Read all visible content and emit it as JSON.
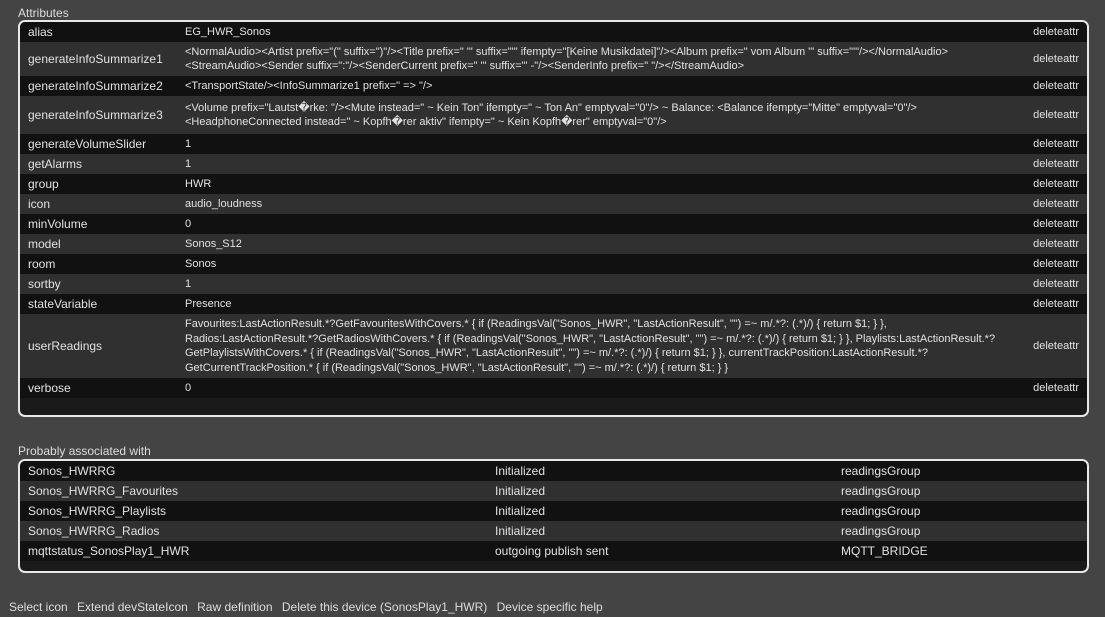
{
  "attributes_title": "Attributes",
  "delete_label": "deleteattr",
  "attributes": [
    {
      "name": "alias",
      "value": "EG_HWR_Sonos"
    },
    {
      "name": "generateInfoSummarize1",
      "value": "<NormalAudio><Artist prefix=\"(\" suffix=\")\"/><Title prefix=\" '\" suffix=\"'\" ifempty=\"[Keine Musikdatei]\"/><Album prefix=\" vom Album '\" suffix=\"'\"/></NormalAudio> <StreamAudio><Sender suffix=\":\"/><SenderCurrent prefix=\" '\" suffix=\"' -\"/><SenderInfo prefix=\" \"/></StreamAudio>"
    },
    {
      "name": "generateInfoSummarize2",
      "value": "<TransportState/><InfoSummarize1 prefix=\" => \"/>"
    },
    {
      "name": "generateInfoSummarize3",
      "value": "<Volume prefix=\"Lautst�rke: \"/><Mute instead=\" ~ Kein Ton\" ifempty=\" ~ Ton An\" emptyval=\"0\"/> ~ Balance: <Balance ifempty=\"Mitte\" emptyval=\"0\"/><HeadphoneConnected instead=\" ~ Kopfh�rer aktiv\" ifempty=\" ~ Kein Kopfh�rer\" emptyval=\"0\"/>"
    },
    {
      "name": "generateVolumeSlider",
      "value": "1"
    },
    {
      "name": "getAlarms",
      "value": "1"
    },
    {
      "name": "group",
      "value": "HWR"
    },
    {
      "name": "icon",
      "value": "audio_loudness"
    },
    {
      "name": "minVolume",
      "value": "0"
    },
    {
      "name": "model",
      "value": "Sonos_S12"
    },
    {
      "name": "room",
      "value": "Sonos"
    },
    {
      "name": "sortby",
      "value": "1"
    },
    {
      "name": "stateVariable",
      "value": "Presence"
    },
    {
      "name": "userReadings",
      "value": "Favourites:LastActionResult.*?GetFavouritesWithCovers.* { if (ReadingsVal(\"Sonos_HWR\", \"LastActionResult\", \"\") =~ m/.*?: (.*)/) { return $1; } }, Radios:LastActionResult.*?GetRadiosWithCovers.* { if (ReadingsVal(\"Sonos_HWR\", \"LastActionResult\", \"\") =~ m/.*?: (.*)/) { return $1; } }, Playlists:LastActionResult.*?GetPlaylistsWithCovers.* { if (ReadingsVal(\"Sonos_HWR\", \"LastActionResult\", \"\") =~ m/.*?: (.*)/) { return $1; } }, currentTrackPosition:LastActionResult.*?GetCurrentTrackPosition.* { if (ReadingsVal(\"Sonos_HWR\", \"LastActionResult\", \"\") =~ m/.*?: (.*)/) { return $1; } }"
    },
    {
      "name": "verbose",
      "value": "0"
    }
  ],
  "associated_title": "Probably associated with",
  "associated": [
    {
      "name": "Sonos_HWRRG",
      "state": "Initialized",
      "type": "readingsGroup"
    },
    {
      "name": "Sonos_HWRRG_Favourites",
      "state": "Initialized",
      "type": "readingsGroup"
    },
    {
      "name": "Sonos_HWRRG_Playlists",
      "state": "Initialized",
      "type": "readingsGroup"
    },
    {
      "name": "Sonos_HWRRG_Radios",
      "state": "Initialized",
      "type": "readingsGroup"
    },
    {
      "name": "mqttstatus_SonosPlay1_HWR",
      "state": "outgoing publish sent",
      "type": "MQTT_BRIDGE"
    }
  ],
  "footer_links": [
    "Select icon",
    "Extend devStateIcon",
    "Raw definition",
    "Delete this device (SonosPlay1_HWR)",
    "Device specific help"
  ]
}
